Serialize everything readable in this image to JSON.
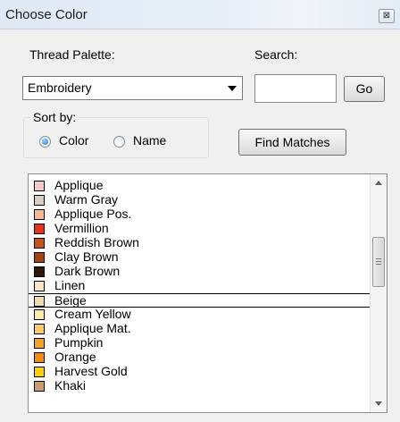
{
  "window": {
    "title": "Choose Color",
    "close_glyph": "⊠"
  },
  "palette": {
    "label": "Thread Palette:",
    "selected": "Embroidery"
  },
  "search": {
    "label": "Search:",
    "value": "",
    "go_label": "Go"
  },
  "sort": {
    "label": "Sort by:",
    "options": [
      {
        "label": "Color",
        "checked": true
      },
      {
        "label": "Name",
        "checked": false
      }
    ]
  },
  "find_matches_label": "Find Matches",
  "colors": [
    {
      "name": "Applique",
      "color": "#f9c8c8"
    },
    {
      "name": "Warm Gray",
      "color": "#d7cec4"
    },
    {
      "name": "Applique Pos.",
      "color": "#f7b98e"
    },
    {
      "name": "Vermillion",
      "color": "#e8311a"
    },
    {
      "name": "Reddish Brown",
      "color": "#c8531a"
    },
    {
      "name": "Clay Brown",
      "color": "#a2440e"
    },
    {
      "name": "Dark Brown",
      "color": "#2d1507"
    },
    {
      "name": "Linen",
      "color": "#f9e2c8"
    },
    {
      "name": "Beige",
      "color": "#eedbb1",
      "selected": true
    },
    {
      "name": "Cream Yellow",
      "color": "#fbeba5"
    },
    {
      "name": "Applique Mat.",
      "color": "#fcc766"
    },
    {
      "name": "Pumpkin",
      "color": "#f4a221"
    },
    {
      "name": "Orange",
      "color": "#f78a13"
    },
    {
      "name": "Harvest Gold",
      "color": "#ffd100"
    },
    {
      "name": "Khaki",
      "color": "#c99e6a"
    }
  ]
}
